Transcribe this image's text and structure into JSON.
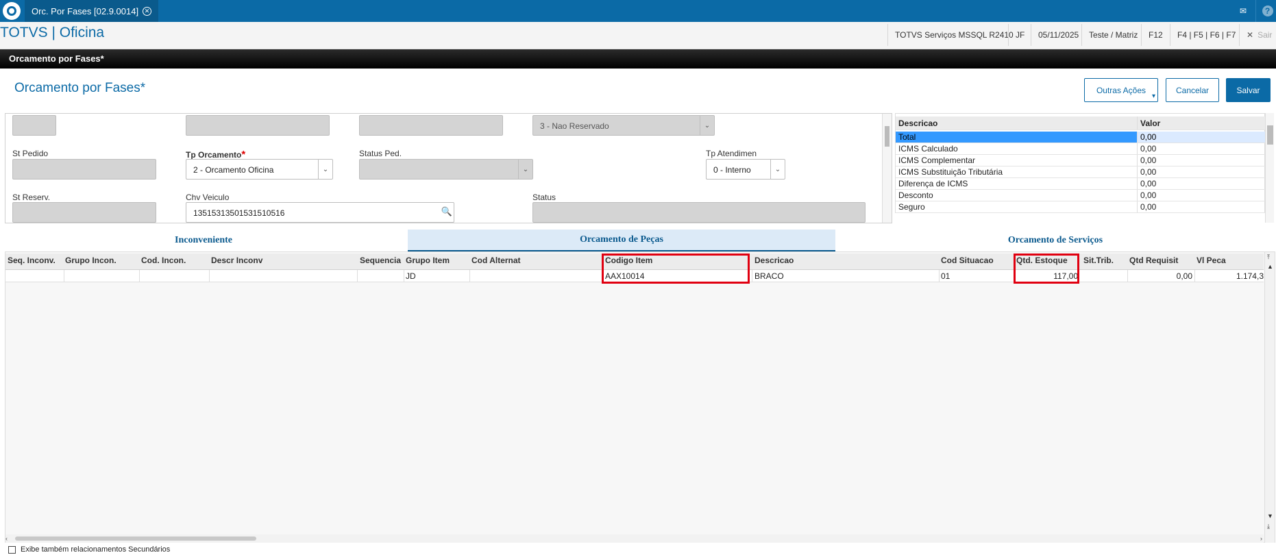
{
  "topbar": {
    "tab_label": "Orc. Por Fases [02.9.0014]",
    "close_glyph": "✕",
    "mail_glyph": "✉",
    "help_glyph": "?"
  },
  "header": {
    "app_title": "TOTVS | Oficina",
    "env": "TOTVS Serviços MSSQL R2410",
    "user": "JF",
    "date": "05/11/2025",
    "company": "Teste / Matriz",
    "help_key": "F12",
    "shortcut_keys": "F4 | F5 | F6 | F7",
    "exit_label": "Sair",
    "exit_glyph": "✕"
  },
  "window_title": "Orcamento por Fases*",
  "page_title": "Orcamento por Fases*",
  "actions": {
    "other": "Outras Ações",
    "other_arrow": "▾",
    "cancel": "Cancelar",
    "save": "Salvar"
  },
  "form": {
    "reserva_value": "3 - Nao Reservado",
    "st_pedido_label": "St Pedido",
    "tp_orcamento_label": "Tp Orcamento",
    "tp_orcamento_required": "*",
    "tp_orcamento_value": "2 - Orcamento Oficina",
    "status_ped_label": "Status Ped.",
    "tp_atendimen_label": "Tp Atendimen",
    "tp_atendimen_value": "0 - Interno",
    "st_reserv_label": "St Reserv.",
    "chv_veiculo_label": "Chv Veiculo",
    "chv_veiculo_value": "13515313501531510516",
    "status_label": "Status",
    "dropdown_glyph": "⌄",
    "search_icon": "🔍"
  },
  "totals": {
    "header": [
      "Descricao",
      "Valor"
    ],
    "rows": [
      [
        "Total",
        "0,00"
      ],
      [
        "ICMS Calculado",
        "0,00"
      ],
      [
        "ICMS Complementar",
        "0,00"
      ],
      [
        "ICMS Substituição Tributária",
        "0,00"
      ],
      [
        "Diferença de ICMS",
        "0,00"
      ],
      [
        "Desconto",
        "0,00"
      ],
      [
        "Seguro",
        "0,00"
      ]
    ],
    "selected_row_color": "#3399ff"
  },
  "tabs": [
    "Inconveniente",
    "Orcamento de Peças",
    "Orcamento de Serviços"
  ],
  "grid": {
    "columns": [
      "Seq. Inconv.",
      "Grupo Incon.",
      "Cod. Incon.",
      "Descr Inconv",
      "Sequencia",
      "Grupo Item",
      "Cod Alternat",
      "Codigo Item",
      "Descricao",
      "Cod Situacao",
      "Qtd. Estoque",
      "Sit.Trib.",
      "Qtd Requisit",
      "Vl Peca"
    ],
    "row": {
      "grupo_item": "JD",
      "codigo_item": "AAX10014",
      "descricao": "BRACO",
      "cod_situacao": "01",
      "qtd_estoque": "117,00",
      "qtd_requisit": "0,00",
      "vl_peca": "1.174,3"
    }
  },
  "footer": {
    "checkbox_label": "Exibe também relacionamentos Secundários"
  },
  "colors": {
    "brand": "#0b6aa6",
    "highlight": "#e00010"
  }
}
